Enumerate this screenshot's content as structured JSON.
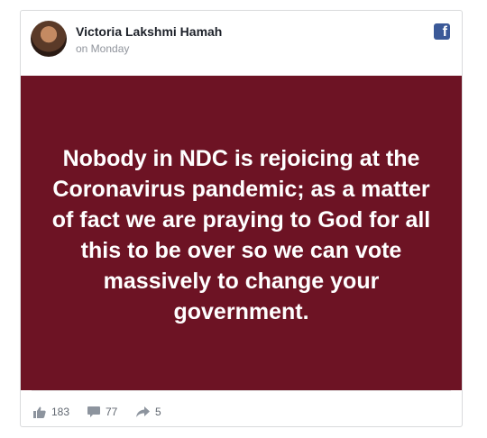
{
  "post": {
    "author": "Victoria Lakshmi Hamah",
    "timestamp": "on Monday",
    "image_text": "Nobody in NDC is rejoicing at the Coronavirus pandemic; as a matter of fact we are praying to God for all this to be over so we can vote massively to change your government.",
    "image_background": "#6d1324",
    "brand_icon": "facebook-icon"
  },
  "stats": {
    "likes": "183",
    "comments": "77",
    "shares": "5"
  }
}
